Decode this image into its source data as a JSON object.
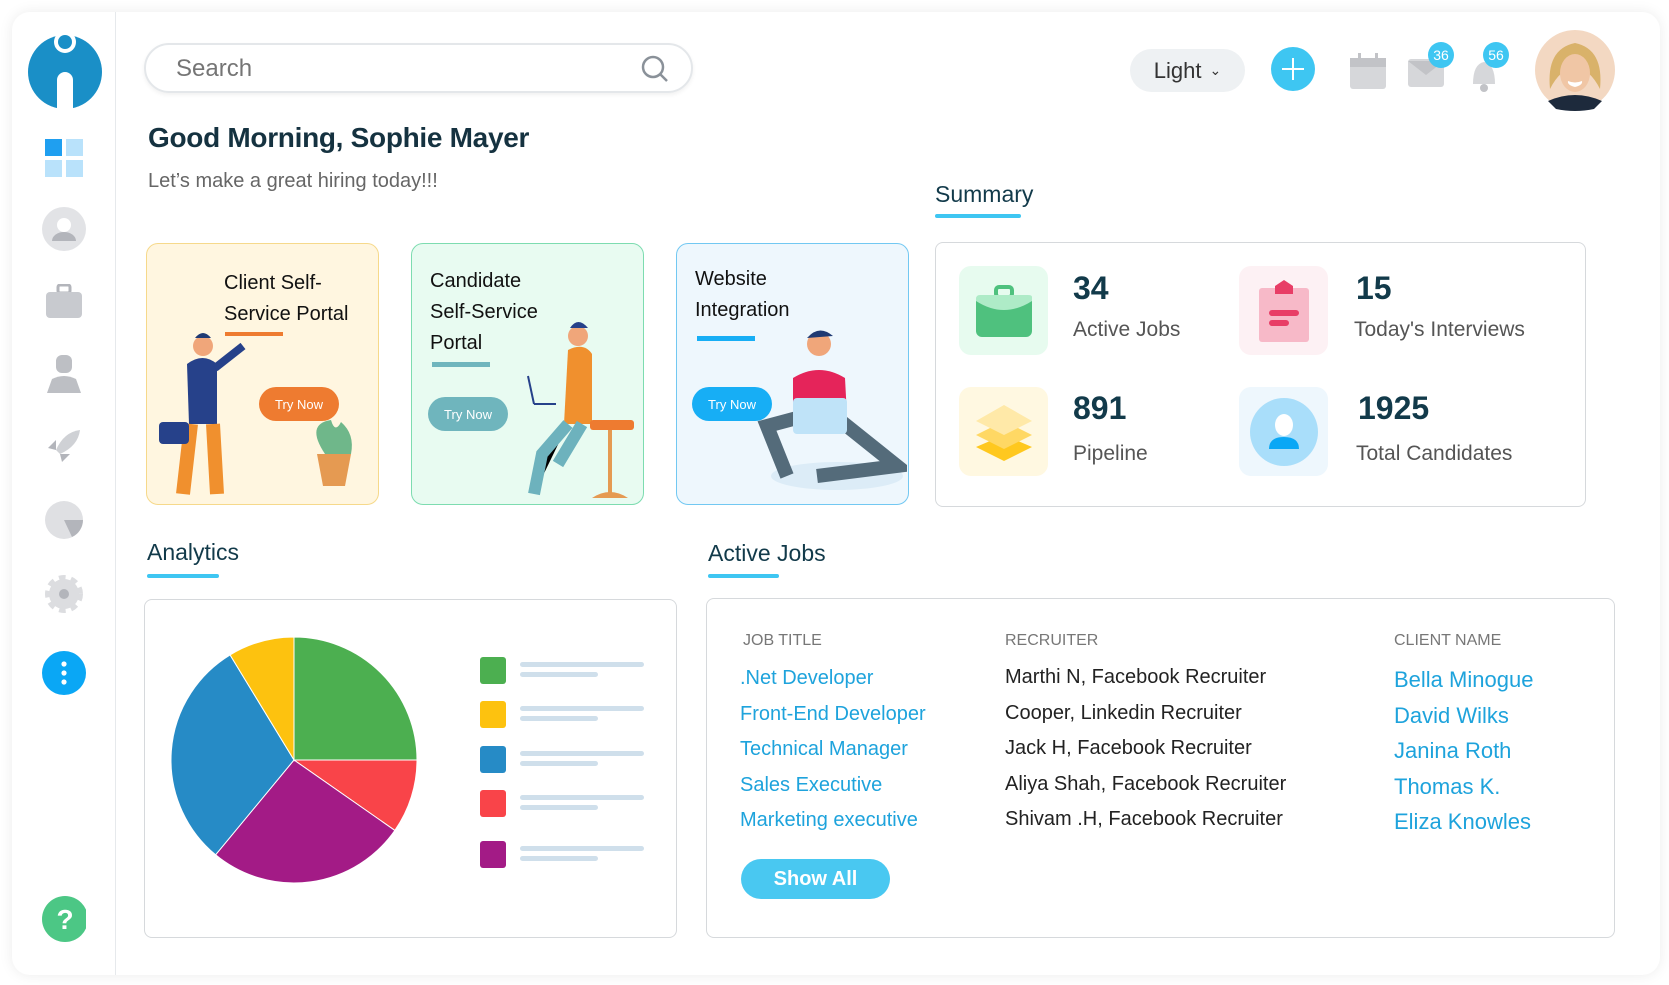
{
  "header": {
    "search_placeholder": "Search",
    "theme_selected": "Light",
    "mail_count": "36",
    "notification_count": "56"
  },
  "greeting": {
    "title": "Good Morning, Sophie Mayer",
    "subtitle": "Let’s make a great hiring today!!!"
  },
  "portals": [
    {
      "title_line1": "Client Self-",
      "title_line2": "Service Portal",
      "title_line3": "",
      "button": "Try Now",
      "accent": "#ee7b30"
    },
    {
      "title_line1": "Candidate",
      "title_line2": "Self-Service",
      "title_line3": "Portal",
      "button": "Try Now",
      "accent": "#6fb5bd"
    },
    {
      "title_line1": "Website",
      "title_line2": "Integration",
      "title_line3": "",
      "button": "Try Now",
      "accent": "#17aef5"
    }
  ],
  "summary": {
    "heading": "Summary",
    "stats": [
      {
        "value": "34",
        "label": "Active Jobs",
        "icon": "briefcase-icon"
      },
      {
        "value": "15",
        "label": "Today's Interviews",
        "icon": "clipboard-icon"
      },
      {
        "value": "891",
        "label": "Pipeline",
        "icon": "layers-icon"
      },
      {
        "value": "1925",
        "label": "Total Candidates",
        "icon": "user-icon"
      }
    ]
  },
  "analytics": {
    "heading": "Analytics"
  },
  "chart_data": {
    "type": "pie",
    "values": [
      25,
      9.7,
      26.3,
      30.3,
      8.7
    ],
    "colors": [
      "#4caf50",
      "#f94449",
      "#a31b86",
      "#268bc6",
      "#fdc20f"
    ],
    "legend_colors": [
      "#4caf50",
      "#fdc20f",
      "#268bc6",
      "#f94449",
      "#a31b86"
    ],
    "legend_placement": "right"
  },
  "active_jobs": {
    "heading": "Active Jobs",
    "columns": [
      "JOB TITLE",
      "RECRUITER",
      "CLIENT NAME"
    ],
    "rows": [
      {
        "job": ".Net Developer",
        "recruiter": "Marthi N, Facebook Recruiter",
        "client": "Bella Minogue"
      },
      {
        "job": "Front-End Developer",
        "recruiter": "Cooper, Linkedin Recruiter",
        "client": "David Wilks"
      },
      {
        "job": "Technical Manager",
        "recruiter": "Jack H, Facebook Recruiter",
        "client": "Janina Roth"
      },
      {
        "job": "Sales Executive",
        "recruiter": "Aliya Shah, Facebook Recruiter",
        "client": "Thomas K."
      },
      {
        "job": "Marketing executive",
        "recruiter": "Shivam .H, Facebook Recruiter",
        "client": "Eliza Knowles"
      }
    ],
    "show_all": "Show All"
  },
  "colors": {
    "accent": "#3ec6f2",
    "brand": "#1a8fc7",
    "link": "#1ea3dc",
    "heading": "#123a4a"
  }
}
